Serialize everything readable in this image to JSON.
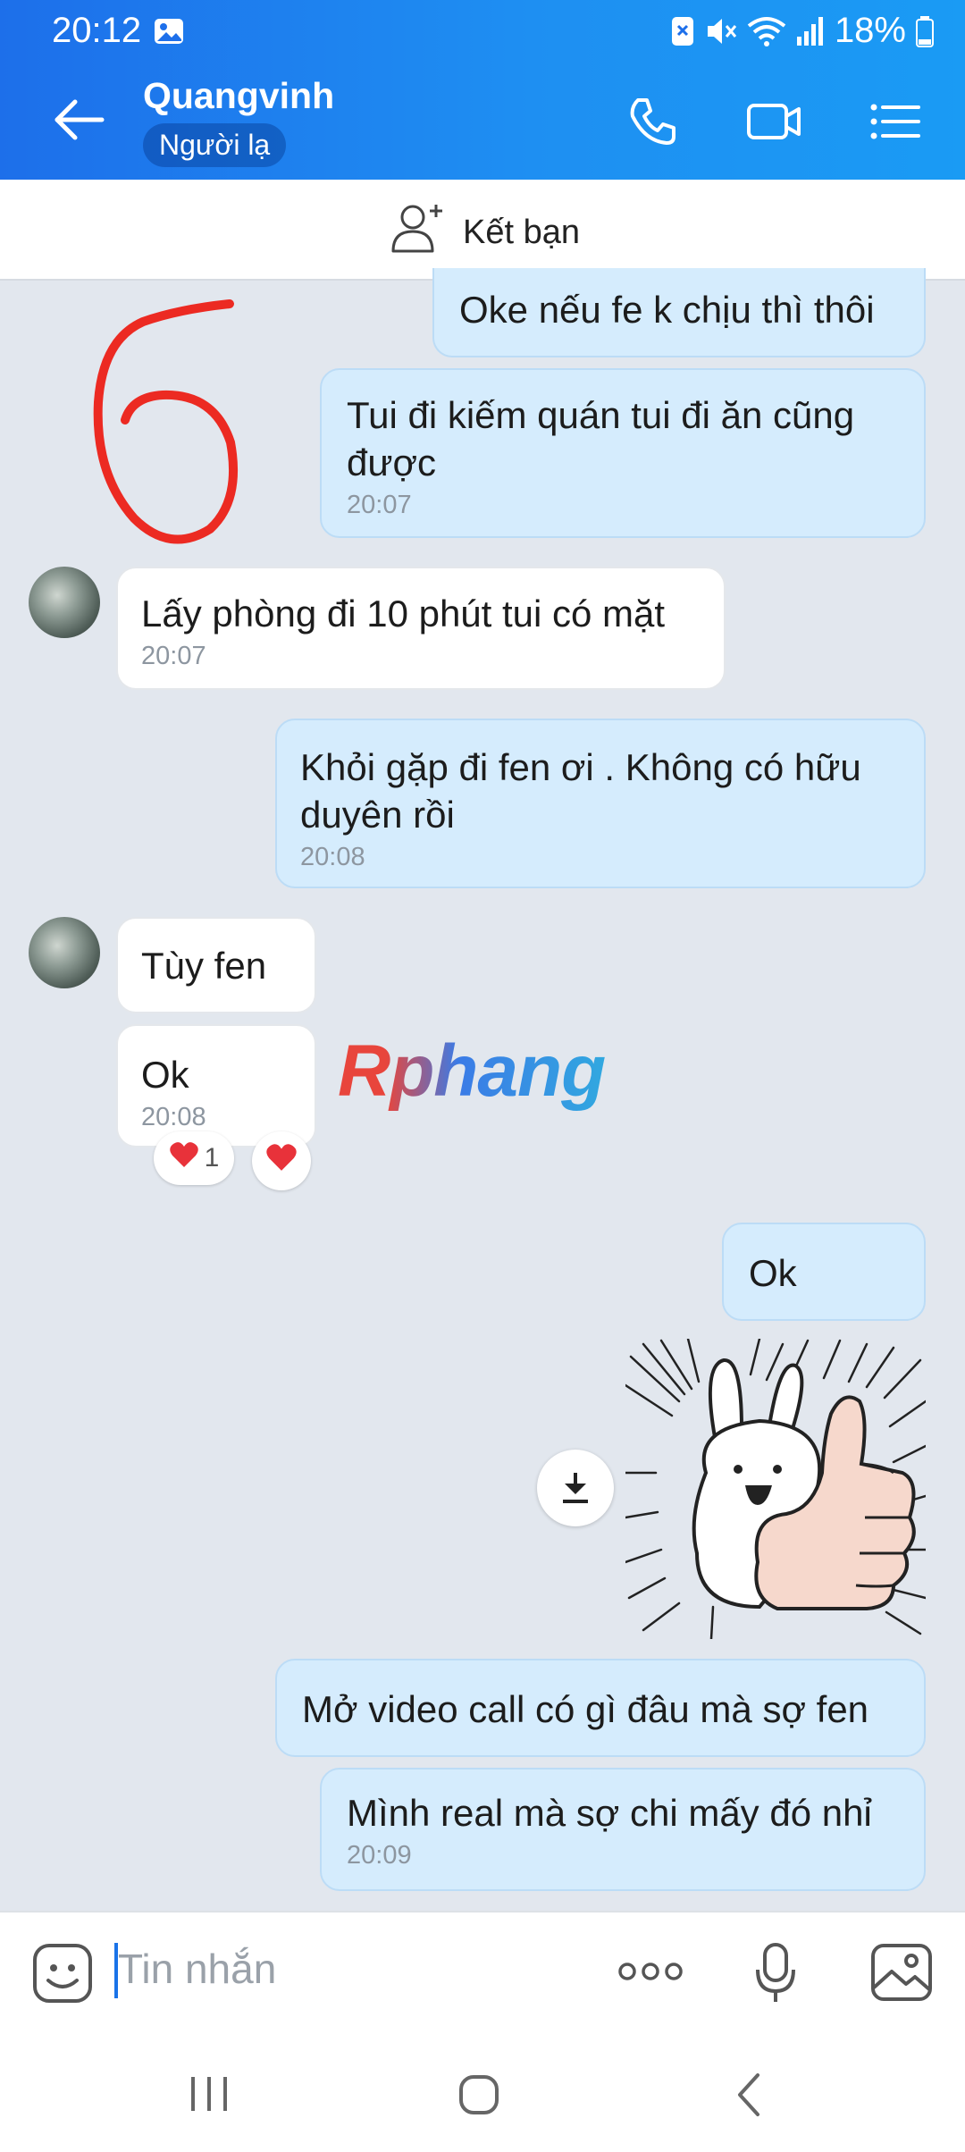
{
  "status": {
    "time": "20:12",
    "battery": "18%"
  },
  "header": {
    "title": "Quangvinh",
    "badge": "Người lạ"
  },
  "addfriend": {
    "label": "Kết bạn"
  },
  "messages": {
    "m1": {
      "text": "Oke nếu fe k chịu thì thôi"
    },
    "m2": {
      "text": "Tui đi kiếm quán tui đi ăn cũng được",
      "time": "20:07"
    },
    "m3": {
      "text": "Lấy phòng đi 10 phút tui có mặt",
      "time": "20:07"
    },
    "m4": {
      "text": "Khỏi gặp đi fen ơi . Không có hữu duyên rồi",
      "time": "20:08"
    },
    "m5": {
      "text": "Tùy fen"
    },
    "m6": {
      "text": "Ok",
      "time": "20:08",
      "reaction_count": "1"
    },
    "m7": {
      "text": "Ok"
    },
    "m9": {
      "text": "Mở video call có gì đâu mà sợ fen"
    },
    "m10": {
      "text": "Mình real mà sợ chi mấy đó nhỉ",
      "time": "20:09"
    }
  },
  "annotation": {
    "text": "6"
  },
  "watermark": {
    "text": "Rphang"
  },
  "input": {
    "placeholder": "Tin nhắn"
  },
  "colors": {
    "header_start": "#1d6fea",
    "header_end": "#1a9bf4",
    "sent_bubble": "#d5ecfd",
    "received_bubble": "#ffffff",
    "background": "#e2e7ee"
  }
}
